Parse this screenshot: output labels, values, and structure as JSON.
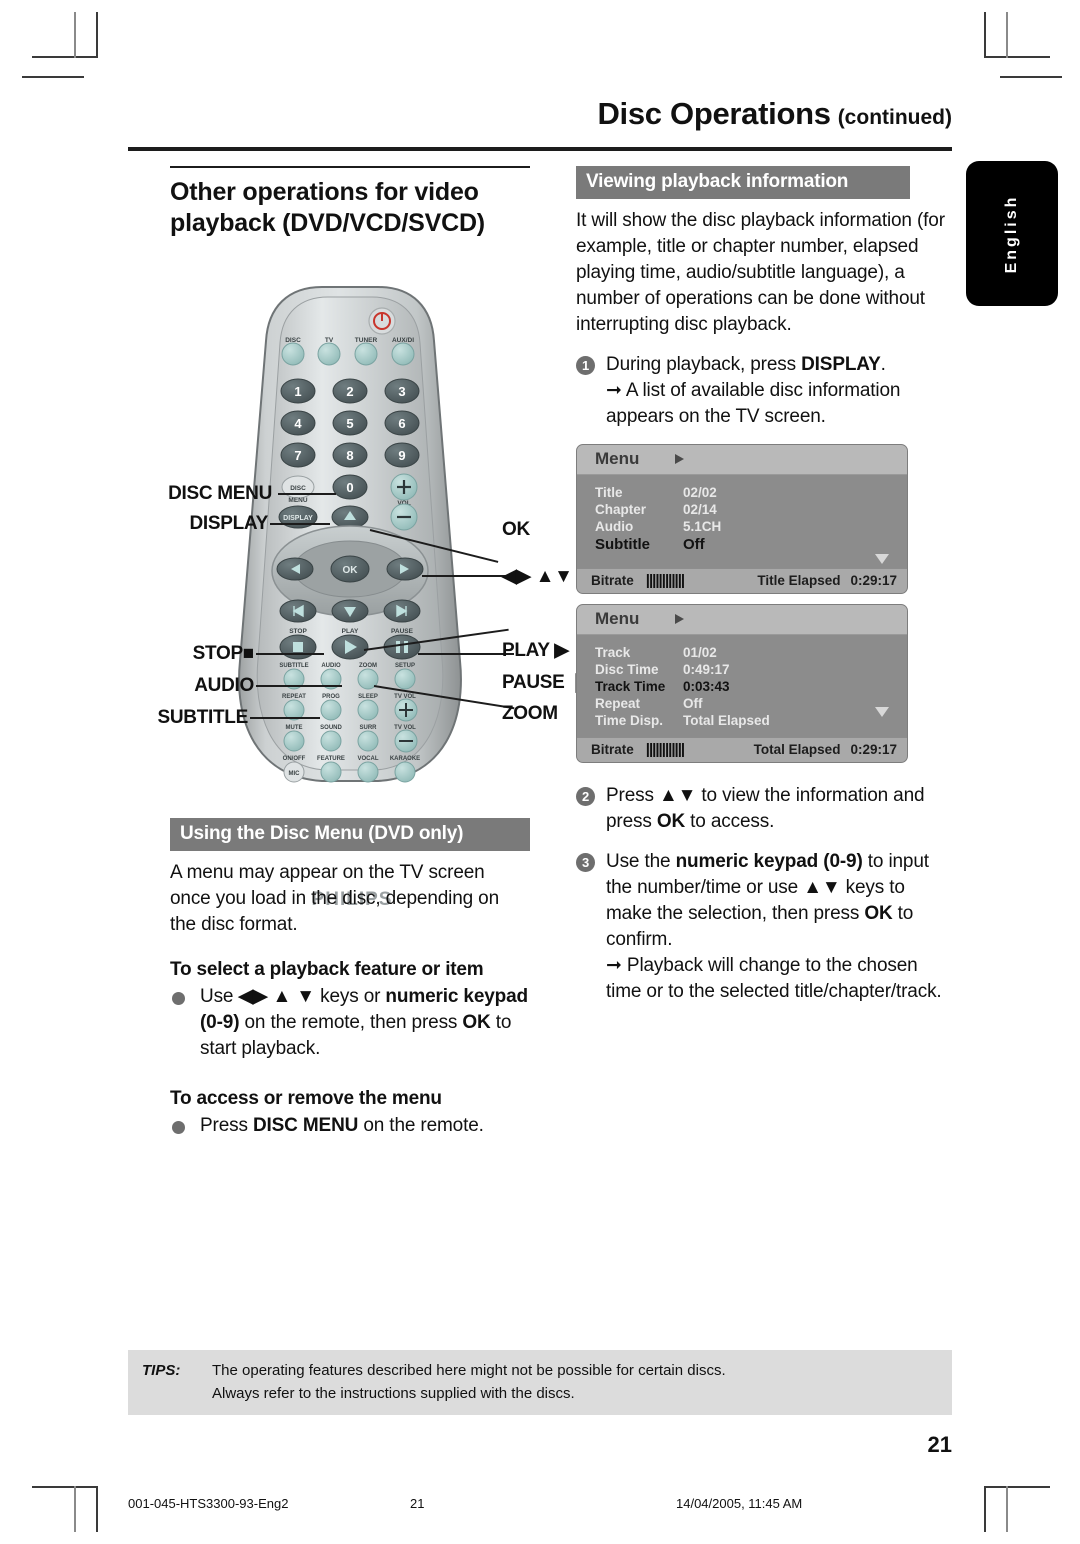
{
  "header": {
    "title": "Disc Operations",
    "continued": "(continued)"
  },
  "language_tab": {
    "label": "English"
  },
  "left_column": {
    "main_heading": "Other operations for video playback (DVD/VCD/SVCD)",
    "remote": {
      "brand": "PHILIPS",
      "callouts_left": [
        "DISC MENU",
        "DISPLAY",
        "STOP■",
        "AUDIO",
        "SUBTITLE"
      ],
      "callouts_right": [
        "OK",
        "◀▶ ▲▼",
        "PLAY ▶",
        "PAUSE ❙❙",
        "ZOOM"
      ],
      "source_buttons": [
        "DISC",
        "TV",
        "TUNER",
        "AUX/DI"
      ],
      "keypad": [
        "1",
        "2",
        "3",
        "4",
        "5",
        "6",
        "7",
        "8",
        "9",
        "0"
      ],
      "labels_row_disc": [
        "DISC",
        "MENU"
      ],
      "label_display": "DISPLAY",
      "label_vol": "VOL",
      "label_ok": "OK",
      "labels_transport": [
        "STOP",
        "PLAY",
        "PAUSE"
      ],
      "labels_feature_row1": [
        "SUBTITLE",
        "AUDIO",
        "ZOOM",
        "SETUP"
      ],
      "labels_feature_row2": [
        "REPEAT",
        "PROG",
        "SLEEP",
        "TV VOL"
      ],
      "labels_feature_row3": [
        "MUTE",
        "SOUND",
        "SURR",
        ""
      ],
      "labels_feature_row4": [
        "ON/OFF",
        "FEATURE",
        "VOCAL",
        "KARAOKE"
      ],
      "label_mic": "MIC"
    },
    "disc_menu_section": {
      "bar_title": "Using the Disc Menu (DVD only)",
      "intro": "A menu may appear on the TV screen once you load in the disc, depending on the disc format.",
      "sub1": "To select a playback feature or item",
      "bullet1_parts": {
        "a": "Use ",
        "arrows1": "◀▶ ▲ ▼",
        "b": " keys or ",
        "bold1": "numeric keypad (0-9)",
        "c": " on the remote, then press ",
        "bold2": "OK",
        "d": " to start playback."
      },
      "sub2": "To access or remove the menu",
      "bullet2_parts": {
        "a": "Press ",
        "bold1": "DISC MENU",
        "b": " on the remote."
      }
    }
  },
  "right_column": {
    "bar_title": "Viewing playback information",
    "intro": "It will show the disc playback information (for example, title or chapter number, elapsed playing time, audio/subtitle language), a number of operations can be done without interrupting disc playback.",
    "steps": [
      {
        "num": "1",
        "text_a": "During playback, press ",
        "bold": "DISPLAY",
        "text_b": ".",
        "result": "A list of available disc information appears on the TV screen."
      },
      {
        "num": "2",
        "text_a": "Press ",
        "arrows": "▲▼",
        "text_b": " to view the information and press ",
        "bold": "OK",
        "text_c": " to access."
      },
      {
        "num": "3",
        "text_a": "Use the ",
        "bold1": "numeric keypad (0-9)",
        "text_b": " to input the number/time or use ",
        "arrows": "▲▼",
        "text_c": " keys to make the selection, then press ",
        "bold2": "OK",
        "text_d": " to confirm.",
        "result": "Playback will change to the chosen time or to the selected title/chapter/track."
      }
    ],
    "osd_screens": [
      {
        "title": "Menu",
        "rows": [
          {
            "key": "Title",
            "value": "02/02",
            "highlight": false
          },
          {
            "key": "Chapter",
            "value": "02/14",
            "highlight": false
          },
          {
            "key": "Audio",
            "value": "5.1CH",
            "highlight": false
          },
          {
            "key": "Subtitle",
            "value": "Off",
            "highlight": true
          }
        ],
        "footer": {
          "bitrate_label": "Bitrate",
          "bitrate_bars": "||||||||||||",
          "time_label": "Title Elapsed",
          "time_value": "0:29:17"
        }
      },
      {
        "title": "Menu",
        "rows": [
          {
            "key": "Track",
            "value": "01/02",
            "highlight": false
          },
          {
            "key": "Disc Time",
            "value": "0:49:17",
            "highlight": false
          },
          {
            "key": "Track Time",
            "value": "0:03:43",
            "highlight": true
          },
          {
            "key": "Repeat",
            "value": "Off",
            "highlight": false
          },
          {
            "key": "Time Disp.",
            "value": "Total Elapsed",
            "highlight": false
          }
        ],
        "footer": {
          "bitrate_label": "Bitrate",
          "bitrate_bars": "||||||||||||",
          "time_label": "Total Elapsed",
          "time_value": "0:29:17"
        }
      }
    ]
  },
  "tips": {
    "label": "TIPS:",
    "line1": "The operating features described here might not be possible for certain discs.",
    "line2": "Always refer to the instructions supplied with the discs."
  },
  "page_number": "21",
  "print_footer": {
    "file": "001-045-HTS3300-93-Eng2",
    "page": "21",
    "date": "14/04/2005, 11:45 AM"
  },
  "colors": {
    "section_bar": "#7a7a7a",
    "tips_bg": "#dcdcdc",
    "lang_tab": "#000000",
    "osd_header": "#b9b9b9",
    "osd_body": "#8c8c8c",
    "osd_footer": "#a9a9a9"
  }
}
